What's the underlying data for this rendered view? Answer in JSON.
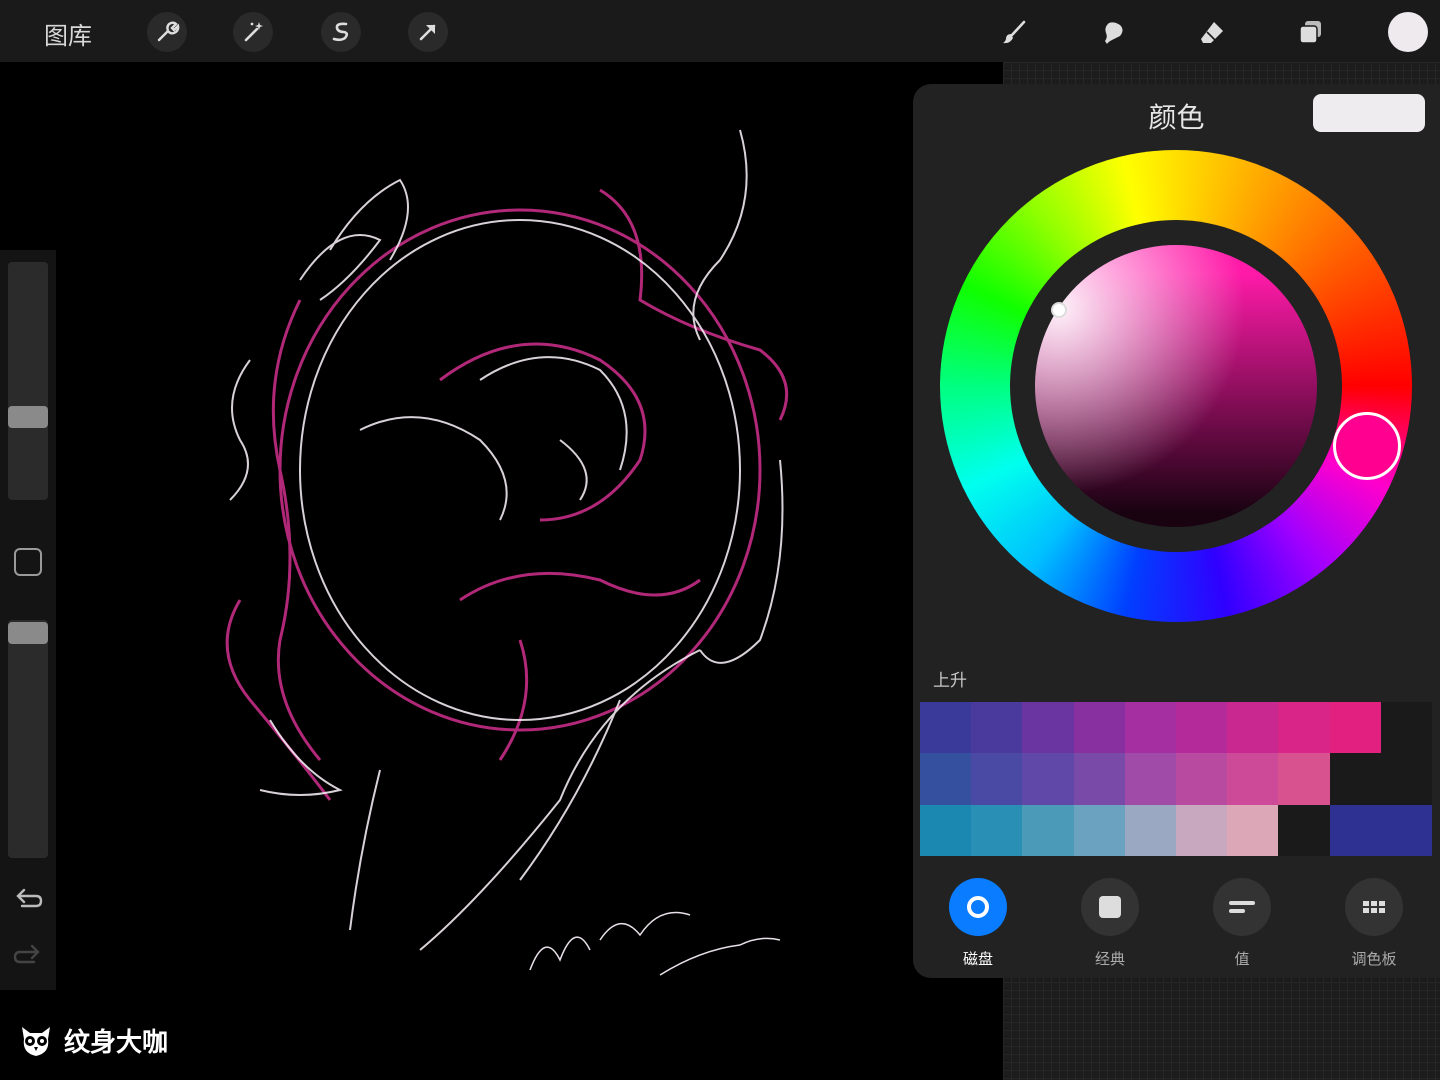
{
  "toolbar": {
    "gallery_label": "图库",
    "left_tools": [
      "wrench-icon",
      "magic-wand-icon",
      "selection-icon",
      "transform-arrow-icon"
    ],
    "right_tools": [
      "brush-icon",
      "smudge-icon",
      "eraser-icon",
      "layers-icon"
    ],
    "current_color": "#eeeaee"
  },
  "sidebar": {
    "brush_size_level": 0.65,
    "opacity_level": 0.9
  },
  "color_panel": {
    "title": "颜色",
    "current_color": "#efecef",
    "hue_color": "#ff0090",
    "history_label": "上升",
    "palette": [
      [
        "#3a3a9a",
        "#4a3a9e",
        "#6a35a0",
        "#88309f",
        "#a52fa0",
        "#b52a9a",
        "#c82890",
        "#da2588",
        "#e22080",
        "#1a1a1a"
      ],
      [
        "#3650a0",
        "#4a4aa5",
        "#6048a8",
        "#7a4aa8",
        "#a04ba8",
        "#b84aa0",
        "#cc4a98",
        "#d85290",
        "#1a1a1a",
        "#1a1a1a"
      ],
      [
        "#1a88b0",
        "#2a8fb5",
        "#4a9ab8",
        "#6aa2c0",
        "#9aa8c2",
        "#c8a8be",
        "#dca8b8",
        "#1a1a1a",
        "#2e3192",
        "#2e3192"
      ]
    ],
    "tabs": [
      {
        "label": "磁盘",
        "icon": "disc-icon",
        "active": true
      },
      {
        "label": "经典",
        "icon": "square-icon",
        "active": false
      },
      {
        "label": "值",
        "icon": "sliders-icon",
        "active": false
      },
      {
        "label": "调色板",
        "icon": "grid-icon",
        "active": false
      }
    ]
  },
  "watermark": {
    "text": "纹身大咖"
  }
}
